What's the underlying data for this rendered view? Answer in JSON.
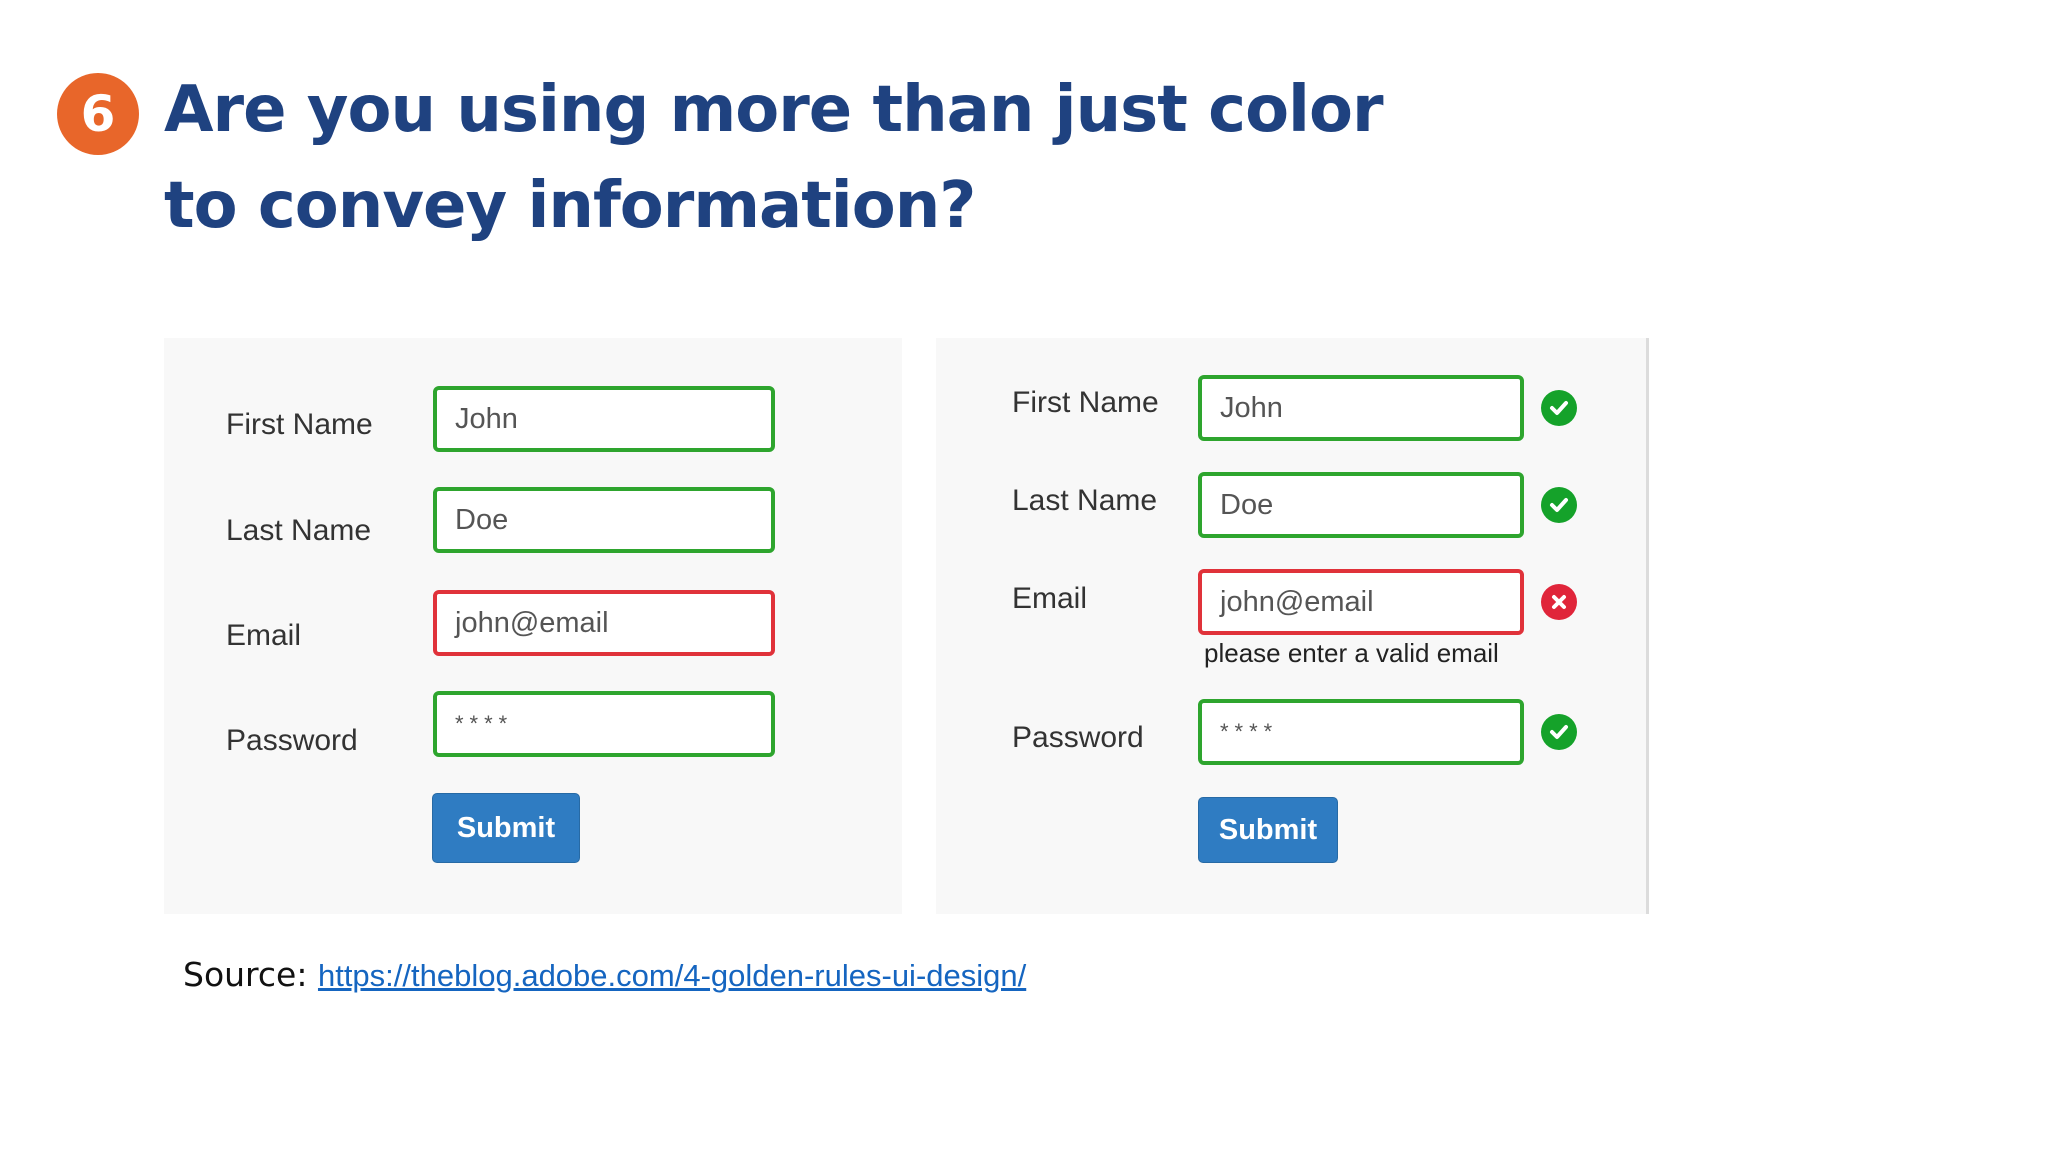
{
  "slide": {
    "number": "6",
    "title": "Are you using more than just color to convey information?"
  },
  "left_form": {
    "first_name_label": "First Name",
    "first_name_value": "John",
    "last_name_label": "Last Name",
    "last_name_value": "Doe",
    "email_label": "Email",
    "email_value": "john@email",
    "password_label": "Password",
    "password_value": "****",
    "submit_label": "Submit"
  },
  "right_form": {
    "first_name_label": "First Name",
    "first_name_value": "John",
    "last_name_label": "Last Name",
    "last_name_value": "Doe",
    "email_label": "Email",
    "email_value": "john@email",
    "email_error": "please enter a valid email",
    "password_label": "Password",
    "password_value": "****",
    "submit_label": "Submit"
  },
  "source": {
    "prefix": "Source:",
    "url": "https://theblog.adobe.com/4-golden-rules-ui-design/"
  },
  "colors": {
    "title": "#1f4280",
    "badge": "#e8662a",
    "valid": "#2ea52e",
    "invalid": "#e0323a",
    "button": "#2f7cc2"
  }
}
